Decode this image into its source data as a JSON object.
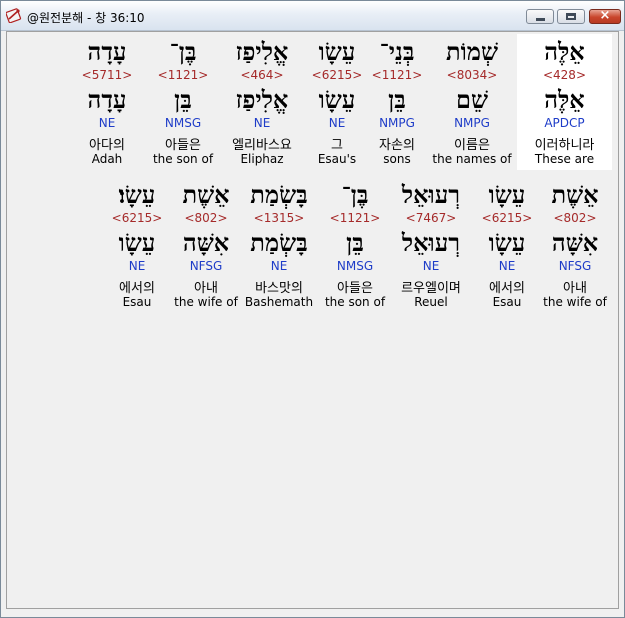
{
  "window": {
    "title": "@원전분해 - 창 36:10",
    "app_icon": "bible-app-icon",
    "buttons": {
      "minimize": "minimize",
      "maximize": "maximize",
      "close": "×"
    }
  },
  "colors": {
    "strong_number": "#a52a2a",
    "parsing_code": "#1e3cc8",
    "hebrew": "#000000",
    "selected_background": "#ffffff"
  },
  "rows": [
    {
      "words": [
        {
          "heb1": "אֵלֶּה",
          "strong": "<428>",
          "heb2": "אֵלֶּה",
          "parse": "APDCP",
          "kor": "이러하니라",
          "eng": "These are"
        },
        {
          "heb1": "שְׁמוֹת",
          "strong": "<8034>",
          "heb2": "שֵׁם",
          "parse": "NMPG",
          "kor": "이름은",
          "eng": "the names of"
        },
        {
          "heb1": "בְּנֵי־",
          "strong": "<1121>",
          "heb2": "בֵּן",
          "parse": "NMPG",
          "kor": "자손의",
          "eng": "sons"
        },
        {
          "heb1": "עֵשָׂו",
          "strong": "<6215>",
          "heb2": "עֵשָׂו",
          "parse": "NE",
          "kor": "그",
          "eng": "Esau's"
        },
        {
          "heb1": "אֱלִיפַז",
          "strong": "<464>",
          "heb2": "אֱלִיפַז",
          "parse": "NE",
          "kor": "엘리바스요",
          "eng": "Eliphaz"
        },
        {
          "heb1": "בֶּן־",
          "strong": "<1121>",
          "heb2": "בֵּן",
          "parse": "NMSG",
          "kor": "아들은",
          "eng": "the son of"
        },
        {
          "heb1": "עָדָה",
          "strong": "<5711>",
          "heb2": "עָדָה",
          "parse": "NE",
          "kor": "아다의",
          "eng": "Adah"
        }
      ]
    },
    {
      "words": [
        {
          "heb1": "אֵשֶׁת",
          "strong": "<802>",
          "heb2": "אִשָּׁה",
          "parse": "NFSG",
          "kor": "아내",
          "eng": "the wife of"
        },
        {
          "heb1": "עֵשָׂו",
          "strong": "<6215>",
          "heb2": "עֵשָׂו",
          "parse": "NE",
          "kor": "에서의",
          "eng": "Esau"
        },
        {
          "heb1": "רְעוּאֵל",
          "strong": "<7467>",
          "heb2": "רְעוּאֵל",
          "parse": "NE",
          "kor": "르우엘이며",
          "eng": "Reuel"
        },
        {
          "heb1": "בֶּן־",
          "strong": "<1121>",
          "heb2": "בֵּן",
          "parse": "NMSG",
          "kor": "아들은",
          "eng": "the son of"
        },
        {
          "heb1": "בָּשְׂמַת",
          "strong": "<1315>",
          "heb2": "בָּשְׂמַת",
          "parse": "NE",
          "kor": "바스맛의",
          "eng": "Bashemath"
        },
        {
          "heb1": "אֵשֶׁת",
          "strong": "<802>",
          "heb2": "אִשָּׁה",
          "parse": "NFSG",
          "kor": "아내",
          "eng": "the wife of"
        },
        {
          "heb1": "עֵשָׂו׃",
          "strong": "<6215>",
          "heb2": "עֵשָׂו",
          "parse": "NE",
          "kor": "에서의",
          "eng": "Esau"
        }
      ]
    }
  ]
}
